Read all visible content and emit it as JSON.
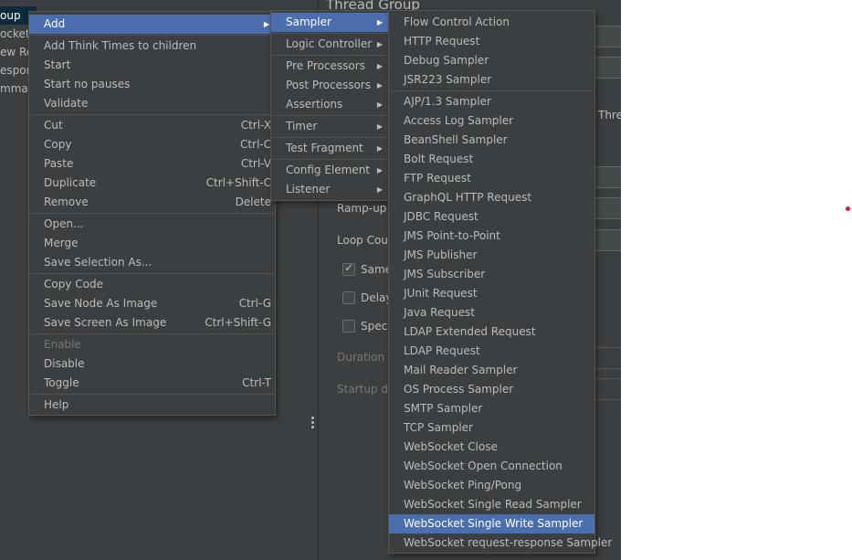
{
  "tree": {
    "items": [
      "oup",
      "ocket S",
      "ew Res",
      "espons",
      "mmar"
    ]
  },
  "panel": {
    "title": "Thread Group",
    "thread_suffix": "Threa",
    "rampup_label": "Ramp-up p",
    "loop_label": "Loop Coun",
    "same_label": "Same",
    "delay_label": "Delay",
    "specify_label": "Speci",
    "duration_label": "Duration (s",
    "startup_label": "Startup de"
  },
  "context_menu": {
    "add": "Add",
    "add_think": "Add Think Times to children",
    "start": "Start",
    "start_no_pauses": "Start no pauses",
    "validate": "Validate",
    "cut": "Cut",
    "cut_sc": "Ctrl-X",
    "copy": "Copy",
    "copy_sc": "Ctrl-C",
    "paste": "Paste",
    "paste_sc": "Ctrl-V",
    "duplicate": "Duplicate",
    "duplicate_sc": "Ctrl+Shift-C",
    "remove": "Remove",
    "remove_sc": "Delete",
    "open": "Open...",
    "merge": "Merge",
    "save_selection": "Save Selection As...",
    "copy_code": "Copy Code",
    "save_node_image": "Save Node As Image",
    "save_node_image_sc": "Ctrl-G",
    "save_screen_image": "Save Screen As Image",
    "save_screen_image_sc": "Ctrl+Shift-G",
    "enable": "Enable",
    "disable": "Disable",
    "toggle": "Toggle",
    "toggle_sc": "Ctrl-T",
    "help": "Help"
  },
  "add_menu": {
    "sampler": "Sampler",
    "logic_controller": "Logic Controller",
    "pre_processors": "Pre Processors",
    "post_processors": "Post Processors",
    "assertions": "Assertions",
    "timer": "Timer",
    "test_fragment": "Test Fragment",
    "config_element": "Config Element",
    "listener": "Listener"
  },
  "sampler_menu": {
    "items": [
      "Flow Control Action",
      "HTTP Request",
      "Debug Sampler",
      "JSR223 Sampler",
      "AJP/1.3 Sampler",
      "Access Log Sampler",
      "BeanShell Sampler",
      "Bolt Request",
      "FTP Request",
      "GraphQL HTTP Request",
      "JDBC Request",
      "JMS Point-to-Point",
      "JMS Publisher",
      "JMS Subscriber",
      "JUnit Request",
      "Java Request",
      "LDAP Extended Request",
      "LDAP Request",
      "Mail Reader Sampler",
      "OS Process Sampler",
      "SMTP Sampler",
      "TCP Sampler",
      "WebSocket Close",
      "WebSocket Open Connection",
      "WebSocket Ping/Pong",
      "WebSocket Single Read Sampler",
      "WebSocket Single Write Sampler",
      "WebSocket request-response Sampler"
    ],
    "selected": "WebSocket Single Write Sampler"
  },
  "colors": {
    "menu_bg": "#3c3f41",
    "highlight": "#4b6eaf",
    "text": "#bbbbbb",
    "disabled_text": "#777777",
    "red_dot": "#e31b1b"
  }
}
